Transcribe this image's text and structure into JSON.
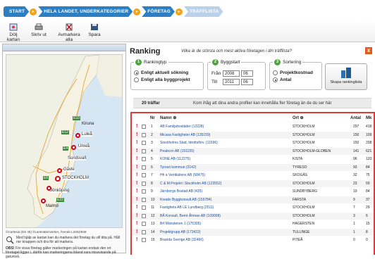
{
  "breadcrumbs": [
    "START",
    "HELA LANDET, UNDERKATEGORIER",
    "FÖRETAG",
    "TRÄFFLISTA"
  ],
  "toolbar": {
    "hide_map": "Dölj kartan",
    "print": "Skriv ut",
    "unmark_all": "Avmarkera alla",
    "save": "Spara"
  },
  "map": {
    "labels": [
      "E10",
      "Kiruna",
      "E12",
      "Luleå",
      "E4",
      "Umeå",
      "Sundsvall",
      "Gävle",
      "STOCKHOLM",
      "E6",
      "Jönköping",
      "E22",
      "Malmö"
    ],
    "copyright": "©Cartesia (DS 45) ©Lantmäteriverket, Ärende L2002/948",
    "help": "Med hjälp av kartan kan du markera det företag du vill titta på. Håll ner knappen och dra för att markera.",
    "obs_label": "OBS!",
    "obs": "För vissa företag gäller markeringen på kartan endast den ort företaget ligger i, därför kan markeringarna ibland vara missvisande på gatunivå."
  },
  "ranking": {
    "title": "Ranking",
    "subtitle": "Vilka är de största och mest aktiva företagen i din träfflista?",
    "close": "x",
    "type_title": "Rankingtyp",
    "type_num": "1",
    "type_opts": [
      "Enligt aktuell sökning",
      "Enligt alla byggprojekt"
    ],
    "period_title": "Byggstart",
    "period_num": "2",
    "from_label": "Från",
    "to_label": "Till",
    "from_year": "2008",
    "from_month": "06",
    "to_year": "2011",
    "to_month": "06",
    "sort_title": "Sortering",
    "sort_num": "3",
    "sort_opts": [
      "Projektkostnad",
      "Antal"
    ],
    "create": "Skapa rankinglista"
  },
  "results": {
    "count": "20 träffar",
    "hint": "Kom ihåg att dina andra profiler kan innehålla fler företag än de du ser här"
  },
  "table": {
    "headers": [
      "Nr",
      "Namn ⊕",
      "Ort ⊕",
      "Antal",
      "Mk"
    ],
    "rows": [
      [
        "1",
        "AB Familjebostäder (12228)",
        "STOCKHOLM",
        "297",
        "418"
      ],
      [
        "2",
        "Micasa Fastigheter AB (135159)",
        "STOCKHOLM",
        "150",
        "109"
      ],
      [
        "3",
        "Stockholms Stad, Idrottsförv. (11596)",
        "STOCKHOLM",
        "150",
        "338"
      ],
      [
        "4",
        "Peabcon AB (151155)",
        "STOCKHOLM-GLOBEN",
        "141",
        "621"
      ],
      [
        "5",
        "KONE AB (112275)",
        "KISTA",
        "96",
        "133"
      ],
      [
        "6",
        "Tyresö kommun (2142)",
        "TYRESO",
        "93",
        "84"
      ],
      [
        "7",
        "Hh a Ventilations AB (58475)",
        "SKOGÅS",
        "32",
        "75"
      ],
      [
        "8",
        "C & M Projekt i Stockholm AB (123552)",
        "STOCKHOLM",
        "23",
        "50"
      ],
      [
        "9",
        "Järnborgs Bostad AB (435)",
        "SUNDBYBERG",
        "19",
        "84"
      ],
      [
        "10",
        "Kreativ Byggkonsult AB (155784)",
        "FARSTA",
        "9",
        "37"
      ],
      [
        "11",
        "Fastighets AB LE Lundberg (2511)",
        "STOCKHOLM",
        "7",
        "29"
      ],
      [
        "12",
        "BÅ Konsult, Bernt Åhman AB (109008)",
        "STOCKHOLM",
        "3",
        "5"
      ],
      [
        "13",
        "Brf Mänstenen 1 (175305)",
        "HAGERSTEN",
        "1",
        "15"
      ],
      [
        "14",
        "Projektgrupp AB (173422)",
        "TULLINGE",
        "1",
        "8"
      ],
      [
        "15",
        "Bravida Sverige AB (32466)",
        "PITEÅ",
        "0",
        "0"
      ]
    ]
  },
  "colors": {
    "accent": "#2c7fc3",
    "orange": "#f5a21b",
    "green": "#4ca63a",
    "red": "#e03a3a"
  }
}
